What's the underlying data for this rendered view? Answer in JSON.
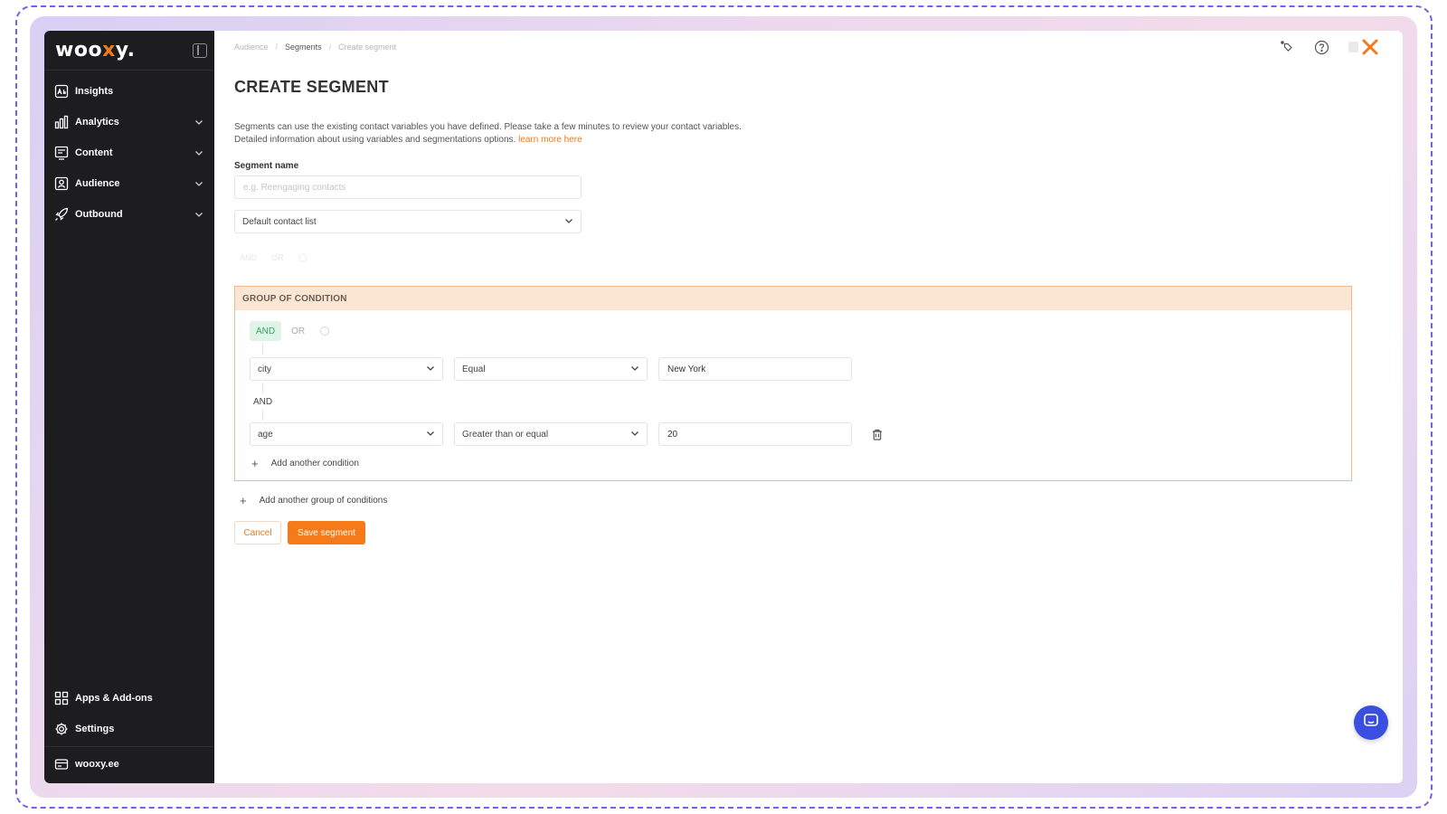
{
  "app": {
    "logo": {
      "pre": "woo",
      "x": "x",
      "post": "y."
    }
  },
  "sidebar": {
    "items": [
      {
        "label": "Insights",
        "icon": "insights-icon",
        "expandable": false
      },
      {
        "label": "Analytics",
        "icon": "bar-chart-icon",
        "expandable": true
      },
      {
        "label": "Content",
        "icon": "content-icon",
        "expandable": true
      },
      {
        "label": "Audience",
        "icon": "audience-icon",
        "expandable": true
      },
      {
        "label": "Outbound",
        "icon": "rocket-icon",
        "expandable": true
      }
    ],
    "bottom_items": [
      {
        "label": "Apps & Add-ons",
        "icon": "apps-grid-icon"
      },
      {
        "label": "Settings",
        "icon": "gear-icon"
      }
    ],
    "account": {
      "label": "wooxy.ee",
      "icon": "card-icon"
    }
  },
  "breadcrumb": [
    "Audience",
    "Segments",
    "Create segment"
  ],
  "page": {
    "title": "CREATE SEGMENT",
    "intro_line1": "Segments can use the existing contact variables you have defined. Please take a few minutes to review your contact variables.",
    "intro_line2": "Detailed information about using variables and segmentations options.",
    "intro_link": "learn more here",
    "segment_name_label": "Segment name",
    "segment_name_placeholder": "e.g. Reengaging contacts",
    "contact_list": "Default contact list",
    "ghost_toggle": [
      "AND",
      "OR"
    ]
  },
  "group": {
    "header": "GROUP OF CONDITION",
    "toggle": {
      "active": "AND",
      "inactive": "OR"
    },
    "conditions": [
      {
        "field": "city",
        "operator": "Equal",
        "value": "New York"
      },
      {
        "field": "age",
        "operator": "Greater than or equal",
        "value": "20"
      }
    ],
    "join_label": "AND",
    "add_condition": "Add another condition"
  },
  "add_group": "Add another group of conditions",
  "buttons": {
    "cancel": "Cancel",
    "save": "Save segment"
  },
  "colors": {
    "accent": "#f47a1a",
    "sidebar_bg": "#1d1d1f",
    "group_border": "#f3b98c",
    "group_header_bg": "#fbe5d3",
    "and_active": "#3aa566",
    "chat_fab": "#3a4fe0"
  }
}
